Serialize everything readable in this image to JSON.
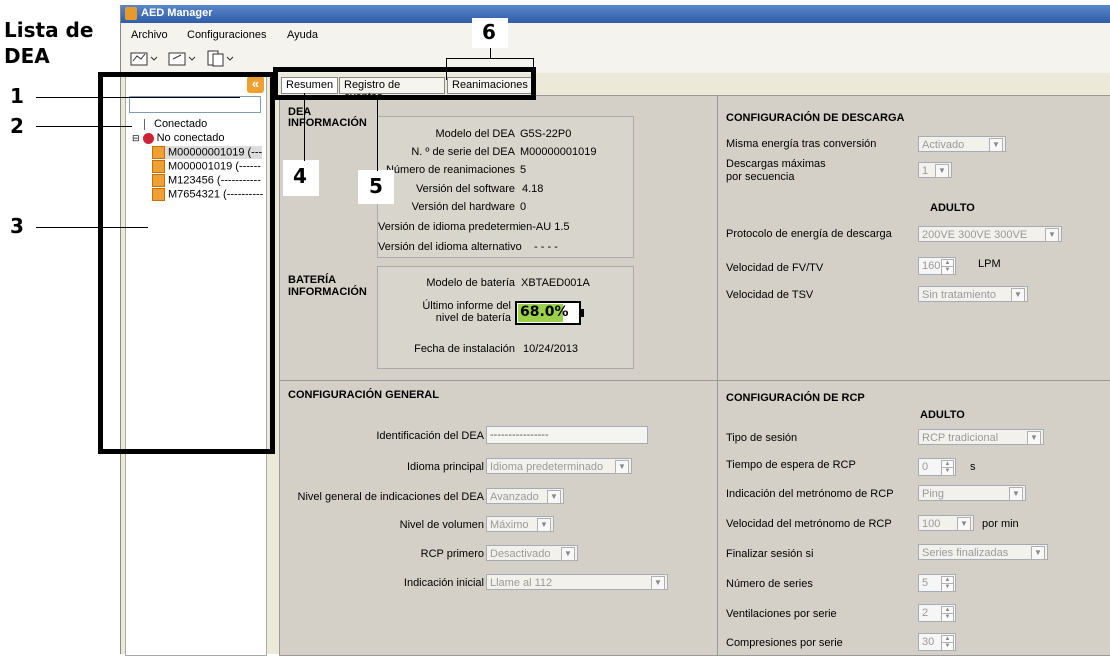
{
  "annotations": {
    "list_label_line1": "Lista de",
    "list_label_line2": "DEA",
    "n1": "1",
    "n2": "2",
    "n3": "3",
    "n4": "4",
    "n5": "5",
    "n6": "6"
  },
  "app": {
    "title": "AED Manager"
  },
  "menu": [
    "Archivo",
    "Configuraciones",
    "Ayuda"
  ],
  "tree": {
    "connected": "Conectado",
    "not_connected": "No conectado",
    "devices": [
      "M00000001019 (---",
      "M000001019 (------",
      "M123456 (-----------",
      "M7654321 (----------"
    ]
  },
  "tabs": [
    "Resumen",
    "Registro de eventos",
    "Reanimaciones"
  ],
  "aed_info": {
    "heading1": "DEA",
    "heading2": "INFORMACIÓN",
    "model_label": "Modelo del DEA",
    "model": "G5S-22P0",
    "serial_label": "N. º de serie del DEA",
    "serial": "M00000001019",
    "rescues_label": "Número de reanimaciones",
    "rescues": "5",
    "sw_label": "Versión del software",
    "sw": "4.18",
    "hw_label": "Versión del hardware",
    "hw": "0",
    "lang_default_label": "Versión de idioma predetermin:",
    "lang_default": "en-AU  1.5",
    "lang_alt_label": "Versión del idioma alternativo",
    "lang_alt": "- - - -"
  },
  "battery": {
    "heading1": "BATERÍA",
    "heading2": "INFORMACIÓN",
    "model_label": "Modelo de batería",
    "model": "XBTAED001A",
    "level_label1": "Último informe del",
    "level_label2": "nivel de batería",
    "level": "68.0%",
    "install_label": "Fecha de instalación",
    "install": "10/24/2013"
  },
  "shock": {
    "title": "CONFIGURACIÓN DE DESCARGA",
    "same_energy_label": "Misma energía tras conversión",
    "same_energy": "Activado",
    "max_shocks_label1": "Descargas máximas",
    "max_shocks_label2": "por secuencia",
    "max_shocks": "1",
    "adult": "ADULTO",
    "protocol_label": "Protocolo de energía de descarga",
    "protocol": "200VE 300VE 300VE",
    "vf_label": "Velocidad de FV/TV",
    "vf": "160",
    "vf_unit": "LPM",
    "svt_label": "Velocidad de TSV",
    "svt": "Sin tratamiento"
  },
  "general": {
    "title": "CONFIGURACIÓN GENERAL",
    "id_label": "Identificación del DEA",
    "id": "----------------",
    "lang_label": "Idioma principal",
    "lang": "Idioma predeterminado",
    "prompt_label": "Nivel general de indicaciones del DEA",
    "prompt": "Avanzado",
    "volume_label": "Nivel de volumen",
    "volume": "Máximo",
    "cpr_first_label": "RCP primero",
    "cpr_first": "Desactivado",
    "initial_label": "Indicación inicial",
    "initial": "Llame al 112"
  },
  "cpr": {
    "title": "CONFIGURACIÓN DE RCP",
    "adult": "ADULTO",
    "session_label": "Tipo de sesión",
    "session": "RCP tradicional",
    "wait_label": "Tiempo de espera de RCP",
    "wait": "0",
    "wait_unit": "s",
    "metro_label": "Indicación del metrónomo de RCP",
    "metro": "Ping",
    "metro_rate_label": "Velocidad del metrónomo de RCP",
    "metro_rate": "100",
    "metro_rate_unit": "por min",
    "end_label": "Finalizar sesión si",
    "end": "Series finalizadas",
    "series_label": "Número de series",
    "series": "5",
    "vent_label": "Ventilaciones por serie",
    "vent": "2",
    "comp_label": "Compresiones por serie",
    "comp": "30"
  }
}
